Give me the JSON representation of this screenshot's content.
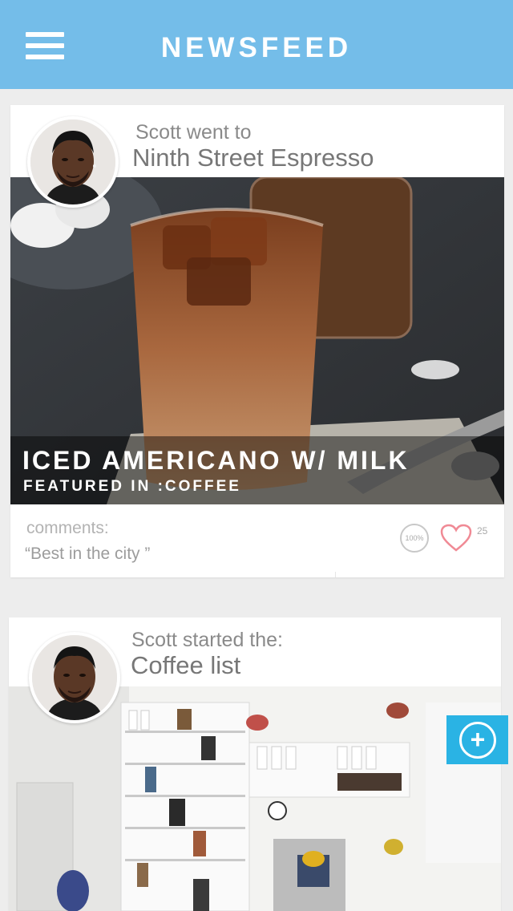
{
  "header": {
    "title": "NEWSFEED",
    "menu_icon": "hamburger-menu-icon"
  },
  "feed": [
    {
      "action": "Scott went to",
      "place": "Ninth Street Espresso",
      "item_title": "ICED AMERICANO W/ MILK",
      "item_subtitle": "FEATURED IN :COFFEE",
      "comments_label": "comments:",
      "comment": "“Best in the city ”",
      "rating": "100%",
      "likes": "25",
      "like_icon": "heart-icon"
    },
    {
      "action": "Scott started the:",
      "place": "Coffee list"
    }
  ],
  "fab": {
    "icon": "plus-circle-icon"
  }
}
